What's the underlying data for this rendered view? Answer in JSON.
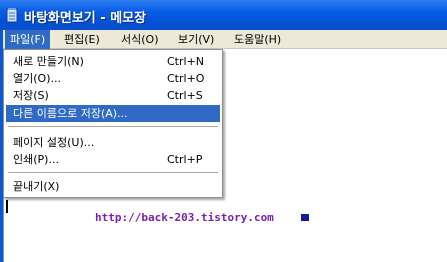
{
  "window": {
    "title": "바탕화면보기 - 메모장",
    "icon": "notepad-icon"
  },
  "menubar": {
    "items": [
      {
        "label": "파일(F)",
        "active": true
      },
      {
        "label": "편집(E)",
        "active": false
      },
      {
        "label": "서식(O)",
        "active": false
      },
      {
        "label": "보기(V)",
        "active": false
      },
      {
        "label": "도움말(H)",
        "active": false
      }
    ]
  },
  "file_menu": {
    "items": [
      {
        "label": "새로 만들기(N)",
        "shortcut": "Ctrl+N"
      },
      {
        "label": "열기(O)...",
        "shortcut": "Ctrl+O"
      },
      {
        "label": "저장(S)",
        "shortcut": "Ctrl+S"
      },
      {
        "label": "다른 이름으로 저장(A)...",
        "shortcut": "",
        "selected": true
      },
      {
        "label": "페이지 설정(U)...",
        "shortcut": ""
      },
      {
        "label": "인쇄(P)...",
        "shortcut": "Ctrl+P"
      },
      {
        "label": "끝내기(X)",
        "shortcut": ""
      }
    ]
  },
  "editor": {
    "text": "http://back-203.tistory.com"
  },
  "colors": {
    "titlebar": "#0a5fe6",
    "menu_highlight": "#316ac5",
    "menubar_bg": "#ece9d8",
    "url_text": "#7a1fb0"
  }
}
